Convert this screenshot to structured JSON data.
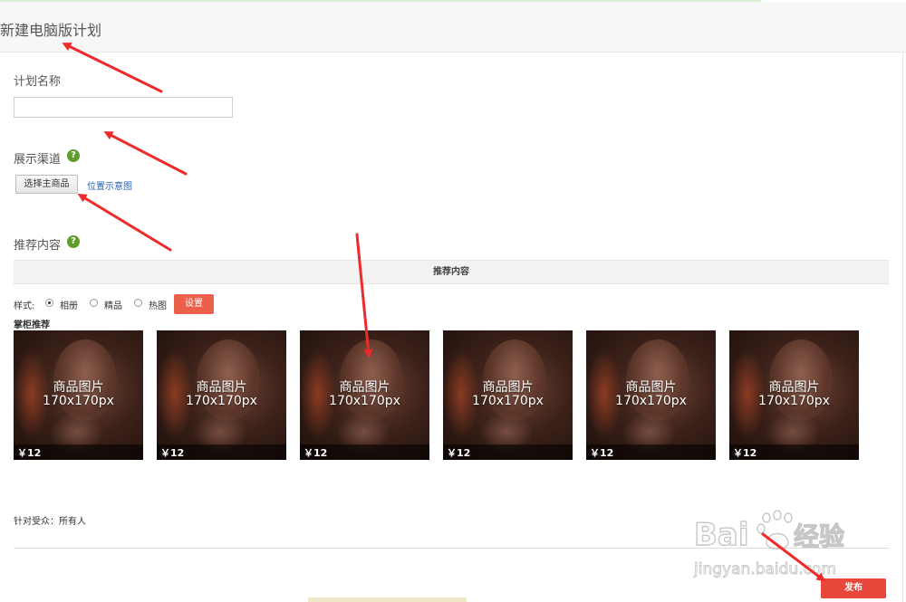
{
  "header": {
    "title": "新建电脑版计划"
  },
  "plan_name": {
    "label": "计划名称",
    "input_value": "",
    "input_placeholder": ""
  },
  "channel": {
    "label": "展示渠道",
    "help_glyph": "?",
    "select_button": "选择主商品",
    "schematic_link": "位置示意图"
  },
  "recommend": {
    "label": "推荐内容",
    "help_glyph": "?",
    "bar_title": "推荐内容",
    "style_label": "样式:",
    "styles": [
      {
        "label": "相册",
        "checked": true
      },
      {
        "label": "精品",
        "checked": false
      },
      {
        "label": "热图",
        "checked": false
      }
    ],
    "settings_button": "设置",
    "shop_reco_title": "掌柜推荐",
    "products": [
      {
        "caption_line1": "商品图片",
        "caption_line2": "170x170px",
        "price": "￥12"
      },
      {
        "caption_line1": "商品图片",
        "caption_line2": "170x170px",
        "price": "￥12"
      },
      {
        "caption_line1": "商品图片",
        "caption_line2": "170x170px",
        "price": "￥12"
      },
      {
        "caption_line1": "商品图片",
        "caption_line2": "170x170px",
        "price": "￥12"
      },
      {
        "caption_line1": "商品图片",
        "caption_line2": "170x170px",
        "price": "￥12"
      },
      {
        "caption_line1": "商品图片",
        "caption_line2": "170x170px",
        "price": "￥12"
      }
    ]
  },
  "audience": {
    "text": "针对受众：所有人"
  },
  "footer": {
    "publish_button": "发布"
  },
  "watermark": {
    "brand": "Bai",
    "brand_cn": "经验",
    "url": "jingyan.baidu.com"
  },
  "colors": {
    "accent_red": "#e8483b",
    "settings_red": "#ec5f4b",
    "help_green": "#5e9e2c",
    "link_blue": "#2a63b5",
    "arrow_red": "#ee2a2a"
  }
}
